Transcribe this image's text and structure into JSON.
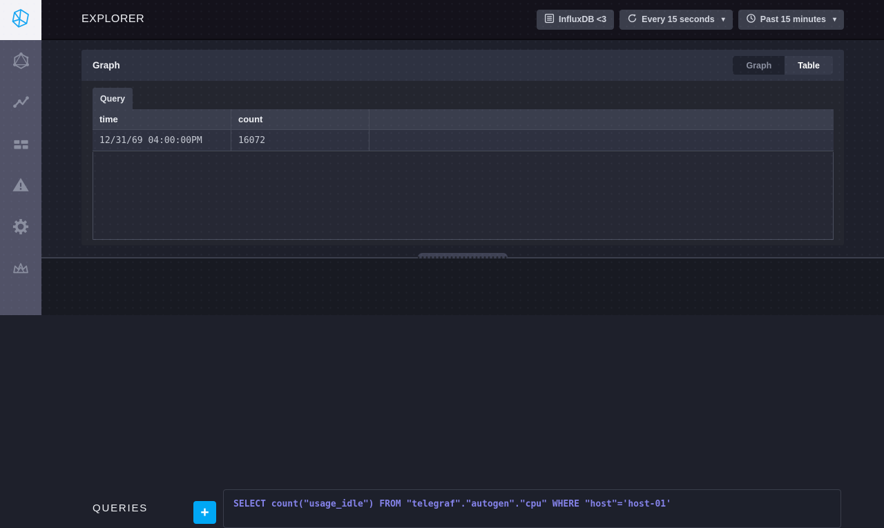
{
  "header": {
    "title": "EXPLORER",
    "buttons": [
      {
        "label": "InfluxDB <3",
        "icon": "source-icon",
        "has_caret": false
      },
      {
        "label": "Every 15 seconds",
        "icon": "refresh-icon",
        "has_caret": true
      },
      {
        "label": "Past 15 minutes",
        "icon": "clock-icon",
        "has_caret": true
      }
    ],
    "caret_glyph": "▾"
  },
  "sidebar": {
    "items": [
      {
        "icon": "influxdb-logo"
      },
      {
        "icon": "hosts-hexagon-icon"
      },
      {
        "icon": "data-explorer-pulse-icon"
      },
      {
        "icon": "dashboards-grid-icon"
      },
      {
        "icon": "alerts-triangle-icon"
      },
      {
        "icon": "admin-gear-icon"
      },
      {
        "icon": "crown-icon"
      }
    ]
  },
  "graph_panel": {
    "title": "Graph",
    "view_toggle": {
      "options": [
        "Graph",
        "Table"
      ],
      "active": "Table"
    },
    "query_tab": "Query",
    "table": {
      "columns": [
        "time",
        "count"
      ],
      "rows": [
        [
          "12/31/69 04:00:00PM",
          "16072"
        ]
      ]
    }
  },
  "queries_panel": {
    "title": "QUERIES",
    "add_button_label": "+",
    "query_text": "SELECT count(\"usage_idle\") FROM \"telegraf\".\"autogen\".\"cpu\" WHERE \"host\"='host-01'"
  },
  "colors": {
    "accent_blue": "#00a7f5",
    "logo_blue": "#14a5f3",
    "query_purple": "#8583ea",
    "sidebar_bg": "#515267",
    "header_bg": "#14121b"
  }
}
